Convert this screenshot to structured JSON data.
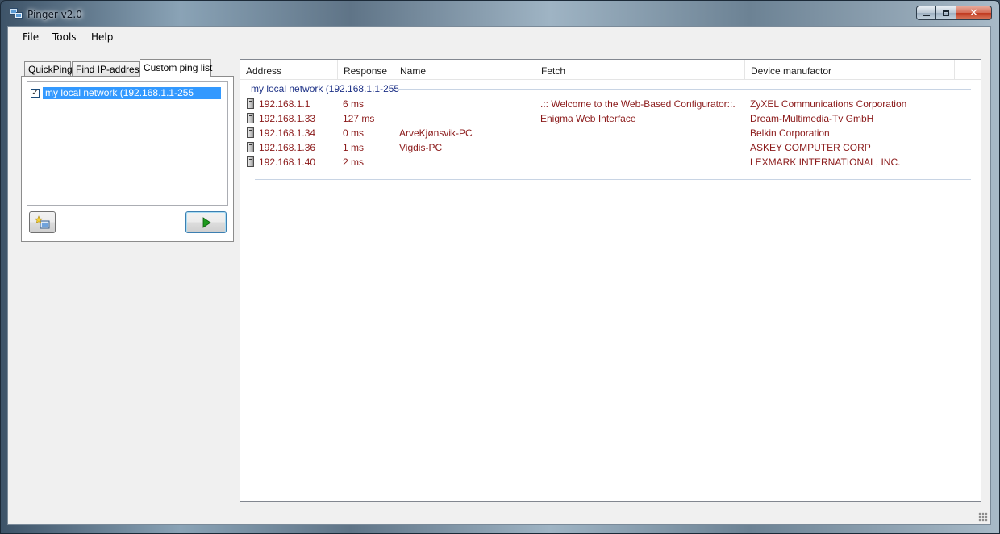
{
  "window": {
    "title": "Pinger v2.0",
    "icon": "network-computers-icon"
  },
  "caption_buttons": {
    "minimize": "minimize-icon",
    "maximize": "maximize-icon",
    "close": "close-icon"
  },
  "menu": [
    "File",
    "Tools",
    "Help"
  ],
  "tabs": [
    "QuickPing",
    "Find IP-address",
    "Custom ping list"
  ],
  "active_tab": "Custom ping list",
  "ping_list": {
    "items": [
      {
        "label": "my local network (192.168.1.1-255",
        "checked": true
      }
    ]
  },
  "buttons": {
    "add": "add-list-icon",
    "run": "play-icon"
  },
  "columns": [
    "Address",
    "Response",
    "Name",
    "Fetch",
    "Device manufactor"
  ],
  "group": {
    "title": "my local network (192.168.1.1-255"
  },
  "rows": [
    {
      "address": "192.168.1.1",
      "response": "6 ms",
      "name": "",
      "fetch": ".:: Welcome to the Web-Based Configurator::.",
      "manufacturer": "ZyXEL Communications Corporation"
    },
    {
      "address": "192.168.1.33",
      "response": "127 ms",
      "name": "",
      "fetch": "Enigma Web Interface",
      "manufacturer": "Dream-Multimedia-Tv GmbH"
    },
    {
      "address": "192.168.1.34",
      "response": "0 ms",
      "name": "ArveKjønsvik-PC",
      "fetch": "",
      "manufacturer": "Belkin Corporation"
    },
    {
      "address": "192.168.1.36",
      "response": "1 ms",
      "name": "Vigdis-PC",
      "fetch": "",
      "manufacturer": "ASKEY  COMPUTER  CORP"
    },
    {
      "address": "192.168.1.40",
      "response": "2 ms",
      "name": "",
      "fetch": "",
      "manufacturer": "LEXMARK INTERNATIONAL, INC."
    }
  ],
  "colors": {
    "row_text": "#8b1a1a",
    "group_title": "#1e3287",
    "selection": "#3399ff"
  }
}
